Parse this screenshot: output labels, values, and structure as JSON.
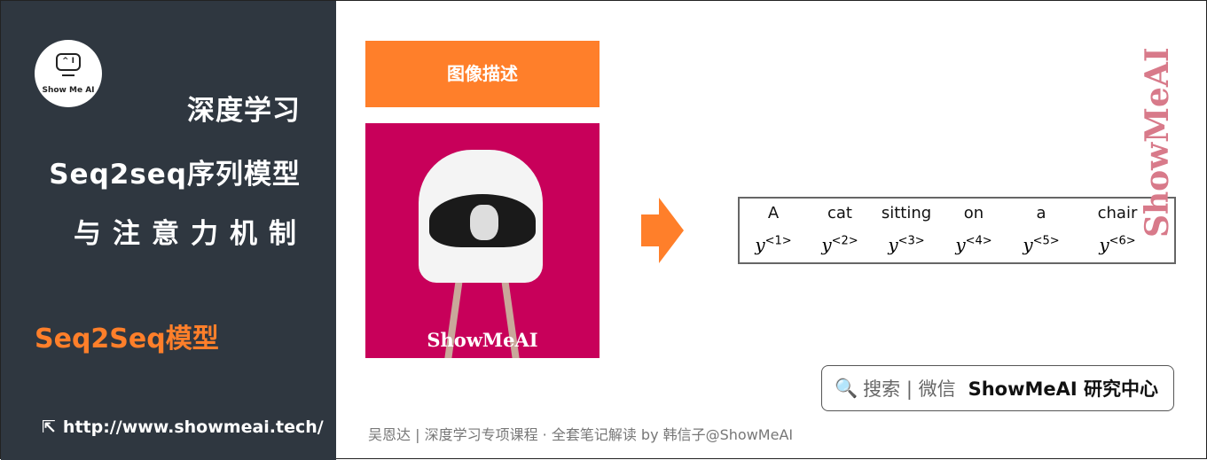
{
  "sidebar": {
    "logo_text": "Show Me AI",
    "title1": "深度学习",
    "title2": "Seq2seq序列模型",
    "title3": "与注意力机制",
    "subtitle": "Seq2Seq模型",
    "url": "http://www.showmeai.tech/"
  },
  "main": {
    "section_button": "图像描述",
    "image_watermark": "ShowMeAI",
    "vertical_watermark": "ShowMeAI",
    "words": [
      "A",
      "cat",
      "sitting",
      "on",
      "a",
      "chair"
    ],
    "outputs": [
      "<1>",
      "<2>",
      "<3>",
      "<4>",
      "<5>",
      "<6>"
    ],
    "output_symbol": "y",
    "search": {
      "label": "搜索 | 微信",
      "brand": "ShowMeAI 研究中心"
    },
    "footer": "吴恩达 | 深度学习专项课程 · 全套笔记解读  by 韩信子@ShowMeAI"
  },
  "colors": {
    "accent": "#ff7f2a",
    "sidebar": "#2f3740",
    "image_bg": "#c8005a"
  }
}
